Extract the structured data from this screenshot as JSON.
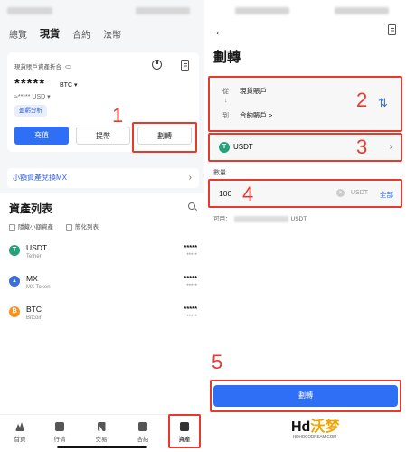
{
  "left": {
    "tabs": [
      "總覽",
      "現貨",
      "合約",
      "法幣"
    ],
    "active_tab": "現貨",
    "account_title": "現貨賬戶資產折合",
    "balance_masked": "*****",
    "balance_unit": "BTC",
    "usd_masked": "≈***** USD",
    "profit_button": "盈虧分析",
    "deposit_button": "充值",
    "withdraw_button": "提幣",
    "transfer_button": "劃轉",
    "small_exchange": "小額資產兌換MX",
    "asset_list_title": "資產列表",
    "hide_small": "隱藏小額資產",
    "simple_list": "簡化列表",
    "assets": [
      {
        "symbol": "USDT",
        "name": "Tether",
        "amount": "*****",
        "amount2": "*****",
        "color": "#26a17b",
        "glyph": "T"
      },
      {
        "symbol": "MX",
        "name": "MX Token",
        "amount": "*****",
        "amount2": "*****",
        "color": "#3a6fd8",
        "glyph": "▲"
      },
      {
        "symbol": "BTC",
        "name": "Bitcoin",
        "amount": "*****",
        "amount2": "*****",
        "color": "#f7931a",
        "glyph": "₿"
      }
    ],
    "nav": [
      "首頁",
      "行情",
      "交易",
      "合約",
      "資產"
    ],
    "active_nav": "資產"
  },
  "right": {
    "title": "劃轉",
    "from_label": "從",
    "from_account": "現貨賬戶",
    "to_label": "到",
    "to_account": "合約賬戶 >",
    "coin": "USDT",
    "qty_label": "數量",
    "qty_value": "100",
    "qty_unit": "USDT",
    "qty_all": "全部",
    "avail_label": "可用：",
    "avail_unit": "USDT",
    "submit": "劃轉"
  },
  "annotations": [
    "1",
    "2",
    "3",
    "4",
    "5"
  ],
  "watermark": {
    "main": "Hd",
    "accent": "沃梦",
    "sub": "HDHOCODREAM.COM"
  },
  "colors": {
    "accent": "#2f6ff5",
    "highlight": "#e8392e"
  }
}
